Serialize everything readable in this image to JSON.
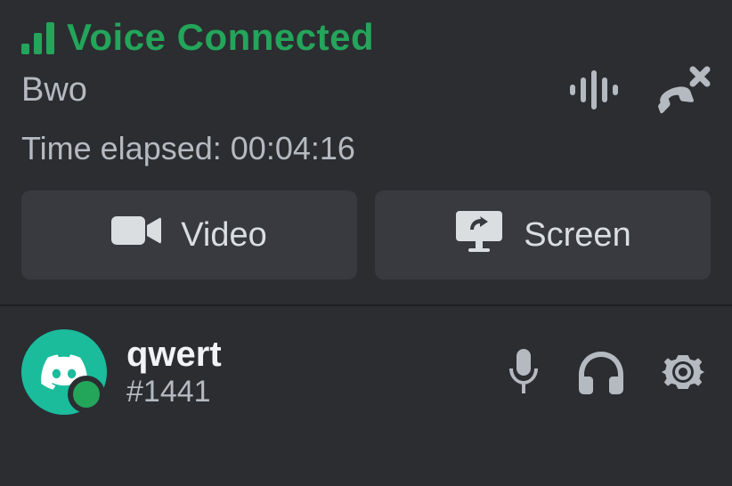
{
  "voice": {
    "status": "Voice Connected",
    "channel": "Bwo",
    "elapsed_label": "Time elapsed: 00:04:16"
  },
  "buttons": {
    "video": "Video",
    "screen": "Screen"
  },
  "user": {
    "name": "qwert",
    "discriminator": "#1441"
  },
  "colors": {
    "accent": "#23a55a",
    "avatar_bg": "#1abc9c"
  }
}
